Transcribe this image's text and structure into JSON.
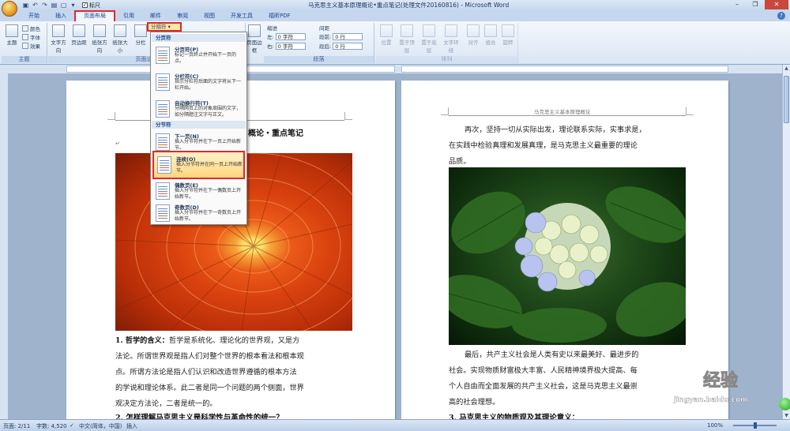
{
  "titlebar": {
    "title": "马克思主义基本原理概论•重点笔记(处理文件20160816) - Microsoft Word",
    "ruler_checkbox_label": "标尺",
    "ruler_checked": true
  },
  "tabs": [
    "开始",
    "插入",
    "页面布局",
    "引用",
    "邮件",
    "审阅",
    "视图",
    "开发工具",
    "福昕PDF"
  ],
  "active_tab": "页面布局",
  "ribbon": {
    "theme_group": {
      "label": "主题",
      "theme_button": "主题",
      "colors": "颜色",
      "fonts": "字体",
      "effects": "效果"
    },
    "page_setup_group": {
      "label": "页面设置",
      "text_direction": "文字方向",
      "margins": "页边距",
      "orientation": "纸张方向",
      "size": "纸张大小",
      "columns": "分栏",
      "breaks_button": "分隔符"
    },
    "page_bg_group": {
      "page_border": "页面边框"
    },
    "paragraph_group": {
      "label": "段落",
      "indent_label": "缩进",
      "spacing_label": "间距",
      "indent_left_label": "左:",
      "indent_left_value": "0 字符",
      "indent_right_label": "右:",
      "indent_right_value": "0 字符",
      "spacing_before_label": "段前:",
      "spacing_before_value": "0 行",
      "spacing_after_label": "段后:",
      "spacing_after_value": "0 行"
    },
    "arrange_group": {
      "label": "排列",
      "position": "位置",
      "bring_front": "置于顶层",
      "send_back": "置于底层",
      "text_wrap": "文字环绕",
      "align": "对齐",
      "group": "组合",
      "rotate": "旋转"
    }
  },
  "breaks_menu": {
    "page_breaks_header": "分页符",
    "section_breaks_header": "分节符",
    "items": [
      {
        "name": "分页符(P)",
        "desc": "标记一页终止并开始下一页的点。"
      },
      {
        "name": "分栏符(C)",
        "desc": "指示分栏符后面的文字将从下一栏开始。"
      },
      {
        "name": "自动换行符(T)",
        "desc": "分隔网页上的对象周围的文字，如分隔题注文字与正文。"
      },
      {
        "name": "下一页(N)",
        "desc": "插入分节符并在下一页上开始新节。"
      },
      {
        "name": "连续(O)",
        "desc": "插入分节符并在同一页上开始新节。"
      },
      {
        "name": "偶数页(E)",
        "desc": "插入分节符并在下一偶数页上开始新节。"
      },
      {
        "name": "奇数页(D)",
        "desc": "插入分节符并在下一奇数页上开始新节。"
      }
    ],
    "highlighted_item": "连续(O)"
  },
  "page_left": {
    "header_text": "概论",
    "title_fragment": "概论・重点笔记",
    "image_alt": "orange chrysanthemum",
    "para1": [
      {
        "bold": "1. 哲学的含义：",
        "text": "哲学是系统化、理论化的世界观，又是方"
      },
      {
        "bold": "",
        "text": "法论。所谓世界观是指人们对整个世界的根本看法和根本观"
      },
      {
        "bold": "",
        "text": "点。所谓方法论是指人们认识和改造世界遵循的根本方法"
      },
      {
        "bold": "",
        "text": "的学说和理论体系。此二者是同一个问题的两个侧面，世界"
      },
      {
        "bold": "",
        "text": "观决定方法论，二者是统一的。"
      }
    ],
    "heading2": "2. 怎样理解马克思主义是科学性与革命性的统一？"
  },
  "page_right": {
    "header_text": "马克思主义基本原理概论",
    "para_top": [
      "再次，坚持一切从实际出发，理论联系实际，实事求是，",
      "在实践中检验真理和发展真理，是马克思主义最重要的理论",
      "品质。"
    ],
    "image_alt": "hydrangea flower",
    "para_bottom": [
      "最后，共产主义社会是人类有史以来最美好、最进步的",
      "社会。实现物质财富极大丰富、人民精神境界极大提高、每",
      "个人自由而全面发展的共产主义社会，这是马克思主义最崇",
      "高的社会理想。"
    ],
    "heading3": "3. 马克思主义的物质观及其理论意义："
  },
  "statusbar": {
    "page": "页面: 2/11",
    "words": "字数: 4,520",
    "language": "中文(简体，中国)",
    "mode": "插入",
    "zoom": "100%"
  },
  "watermark": {
    "text": "经验",
    "url": "jingyan.baidu.com"
  },
  "colors": {
    "highlight_border": "#e0282e",
    "ribbon_bg": "#dbe6f4",
    "doc_bg": "#9fb3cd"
  }
}
